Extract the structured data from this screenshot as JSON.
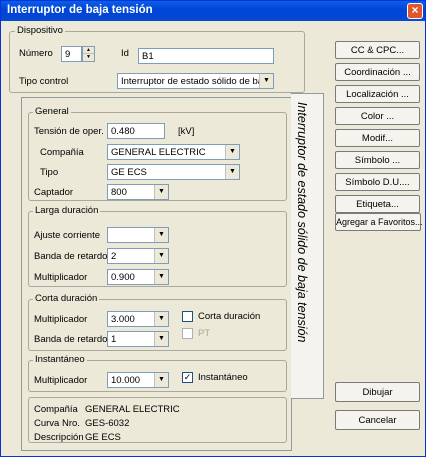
{
  "window": {
    "title": "Interruptor de baja tensión",
    "close": "×"
  },
  "dispositivo": {
    "legend": "Dispositivo",
    "numero_label": "Número",
    "numero_value": "9",
    "id_label": "Id",
    "id_value": "B1",
    "tipo_control_label": "Tipo control",
    "tipo_control_value": "Interruptor de estado sólido de baja"
  },
  "tab": {
    "label": "Interruptor de estado sólido de baja tensión"
  },
  "general": {
    "legend": "General",
    "tension_label": "Tensión de oper.",
    "tension_value": "0.480",
    "tension_unit": "[kV]",
    "compania_label": "Compañía",
    "compania_value": "GENERAL ELECTRIC",
    "tipo_label": "Tipo",
    "tipo_value": "GE ECS",
    "captador_label": "Captador",
    "captador_value": "800"
  },
  "larga": {
    "legend": "Larga duración",
    "ajuste_label": "Ajuste corriente",
    "ajuste_value": "",
    "banda_label": "Banda de retardo",
    "banda_value": "2",
    "mult_label": "Multiplicador",
    "mult_value": "0.900"
  },
  "corta": {
    "legend": "Corta duración",
    "mult_label": "Multiplicador",
    "mult_value": "3.000",
    "banda_label": "Banda de retardo",
    "banda_value": "1",
    "check_label": "Corta duración",
    "pt_label": "PT"
  },
  "inst": {
    "legend": "Instantáneo",
    "mult_label": "Multiplicador",
    "mult_value": "10.000",
    "check_label": "Instantáneo",
    "check_mark": "✓"
  },
  "info": {
    "compania_label": "Compañía",
    "compania_value": "GENERAL ELECTRIC",
    "curva_label": "Curva Nro.",
    "curva_value": "GES-6032",
    "descripcion_label": "Descripción",
    "descripcion_value": "GE ECS"
  },
  "buttons": {
    "cc_cpc": "CC & CPC...",
    "coordinacion": "Coordinación ...",
    "localizacion": "Localización ...",
    "color": "Color ...",
    "modif": "Modif...",
    "simbolo": "Símbolo ...",
    "simbolo_du": "Símbolo D.U....",
    "etiqueta": "Etiqueta...",
    "favoritos": "Agregar a Favoritos...",
    "dibujar": "Dibujar",
    "cancelar": "Cancelar"
  },
  "icons": {
    "dropdown": "▼",
    "spin_up": "▲",
    "spin_down": "▼"
  }
}
